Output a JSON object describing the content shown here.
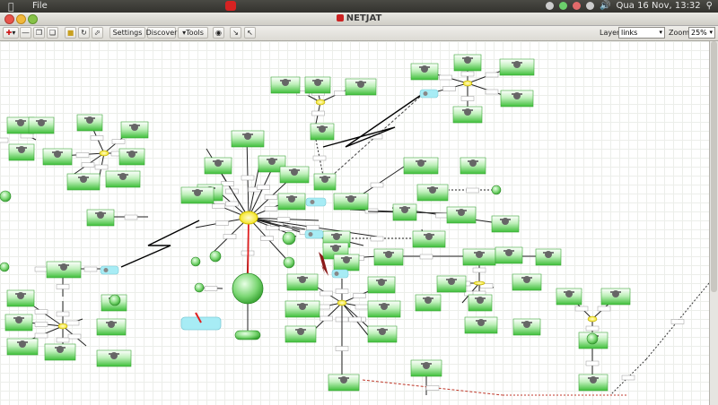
{
  "menubar": {
    "apple_icon": "apple-icon",
    "file_label": "File",
    "clock": "Qua 16 Nov, 13:32"
  },
  "app": {
    "title": "NETJAT"
  },
  "toolbar": {
    "settings_label": "Settings",
    "discover_label": "Discover",
    "tools_label": "Tools",
    "layer_label": "Layer:",
    "layer_value": "links",
    "zoom_label": "Zoom:",
    "zoom_value": "25%"
  },
  "colors": {
    "node_green": "#4fc24a",
    "hub_yellow": "#f5e800",
    "cloud_cyan": "#a7ecf5",
    "link_red": "#e02020"
  }
}
